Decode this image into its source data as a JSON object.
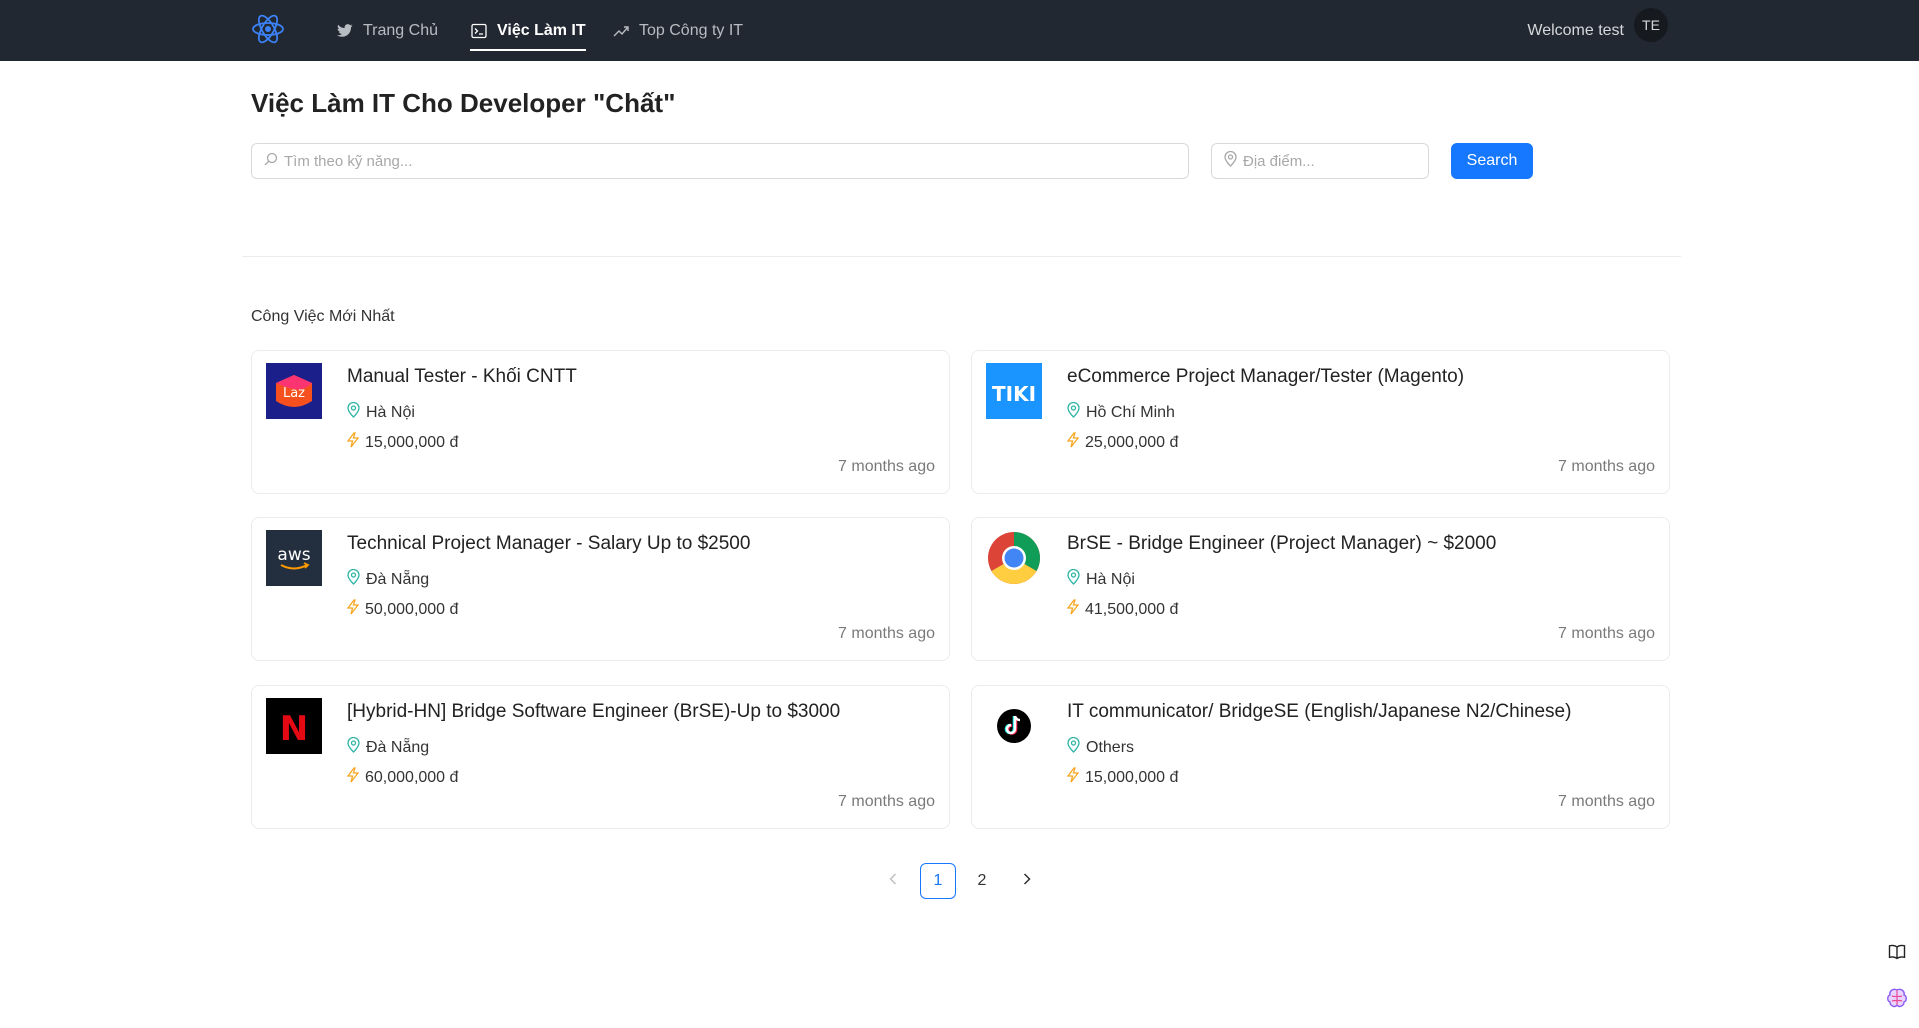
{
  "header": {
    "logo_icon": "react-logo-icon",
    "nav": [
      {
        "label": "Trang Chủ",
        "icon": "twitter-bird-icon",
        "active": false
      },
      {
        "label": "Việc Làm IT",
        "icon": "terminal-icon",
        "active": true
      },
      {
        "label": "Top Công ty IT",
        "icon": "trend-up-icon",
        "active": false
      }
    ],
    "welcome": "Welcome test",
    "avatar_initials": "TE"
  },
  "main": {
    "title": "Việc Làm IT Cho Developer \"Chất\"",
    "search": {
      "skill_placeholder": "Tìm theo kỹ năng...",
      "location_placeholder": "Địa điểm...",
      "button_label": "Search"
    },
    "section_title": "Công Việc Mới Nhất",
    "jobs": [
      {
        "company_logo": "Laz",
        "title": "Manual Tester - Khối CNTT",
        "location": "Hà Nội",
        "salary": "15,000,000 đ",
        "posted": "7 months ago"
      },
      {
        "company_logo": "TIKI",
        "title": "eCommerce Project Manager/Tester (Magento)",
        "location": "Hồ Chí Minh",
        "salary": "25,000,000 đ",
        "posted": "7 months ago"
      },
      {
        "company_logo": "aws",
        "title": "Technical Project Manager - Salary Up to $2500",
        "location": "Đà Nẵng",
        "salary": "50,000,000 đ",
        "posted": "7 months ago"
      },
      {
        "company_logo": "chrome",
        "title": "BrSE - Bridge Engineer (Project Manager) ~ $2000",
        "location": "Hà Nội",
        "salary": "41,500,000 đ",
        "posted": "7 months ago"
      },
      {
        "company_logo": "N",
        "title": "[Hybrid-HN] Bridge Software Engineer (BrSE)-Up to $3000",
        "location": "Đà Nẵng",
        "salary": "60,000,000 đ",
        "posted": "7 months ago"
      },
      {
        "company_logo": "tiktok",
        "title": "IT communicator/ BridgeSE (English/Japanese N2/Chinese)",
        "location": "Others",
        "salary": "15,000,000 đ",
        "posted": "7 months ago"
      }
    ],
    "pagination": {
      "pages": [
        "1",
        "2"
      ],
      "current": "1"
    }
  },
  "colors": {
    "header_bg": "#222831",
    "primary": "#1677ff",
    "location_icon": "#2fb5a8",
    "salary_icon": "#f5a623"
  }
}
